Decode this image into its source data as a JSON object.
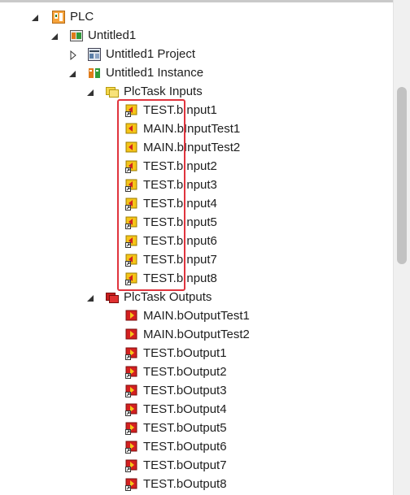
{
  "tree": {
    "root": {
      "label": "PLC",
      "icon": "plc-project-icon"
    },
    "project": {
      "label": "Untitled1",
      "icon": "plc-module-icon"
    },
    "project_sub": {
      "label": "Untitled1 Project",
      "icon": "plc-project-file-icon"
    },
    "instance": {
      "label": "Untitled1 Instance",
      "icon": "plc-instance-icon"
    },
    "inputs_folder": {
      "label": "PlcTask Inputs",
      "icon": "inputs-folder-icon"
    },
    "inputs": [
      {
        "label": "TEST.bInput1",
        "icon": "input-var-linked-icon"
      },
      {
        "label": "MAIN.bInputTest1",
        "icon": "input-var-icon"
      },
      {
        "label": "MAIN.bInputTest2",
        "icon": "input-var-icon"
      },
      {
        "label": "TEST.bInput2",
        "icon": "input-var-linked-icon"
      },
      {
        "label": "TEST.bInput3",
        "icon": "input-var-linked-icon"
      },
      {
        "label": "TEST.bInput4",
        "icon": "input-var-linked-icon"
      },
      {
        "label": "TEST.bInput5",
        "icon": "input-var-linked-icon"
      },
      {
        "label": "TEST.bInput6",
        "icon": "input-var-linked-icon"
      },
      {
        "label": "TEST.bInput7",
        "icon": "input-var-linked-icon"
      },
      {
        "label": "TEST.bInput8",
        "icon": "input-var-linked-icon"
      }
    ],
    "outputs_folder": {
      "label": "PlcTask Outputs",
      "icon": "outputs-folder-icon"
    },
    "outputs": [
      {
        "label": "MAIN.bOutputTest1",
        "icon": "output-var-icon"
      },
      {
        "label": "MAIN.bOutputTest2",
        "icon": "output-var-icon"
      },
      {
        "label": "TEST.bOutput1",
        "icon": "output-var-linked-icon"
      },
      {
        "label": "TEST.bOutput2",
        "icon": "output-var-linked-icon"
      },
      {
        "label": "TEST.bOutput3",
        "icon": "output-var-linked-icon"
      },
      {
        "label": "TEST.bOutput4",
        "icon": "output-var-linked-icon"
      },
      {
        "label": "TEST.bOutput5",
        "icon": "output-var-linked-icon"
      },
      {
        "label": "TEST.bOutput6",
        "icon": "output-var-linked-icon"
      },
      {
        "label": "TEST.bOutput7",
        "icon": "output-var-linked-icon"
      },
      {
        "label": "TEST.bOutput8",
        "icon": "output-var-linked-icon"
      }
    ]
  },
  "colors": {
    "highlight": "#e0343e",
    "input": "#f5c518",
    "output": "#d42020"
  }
}
